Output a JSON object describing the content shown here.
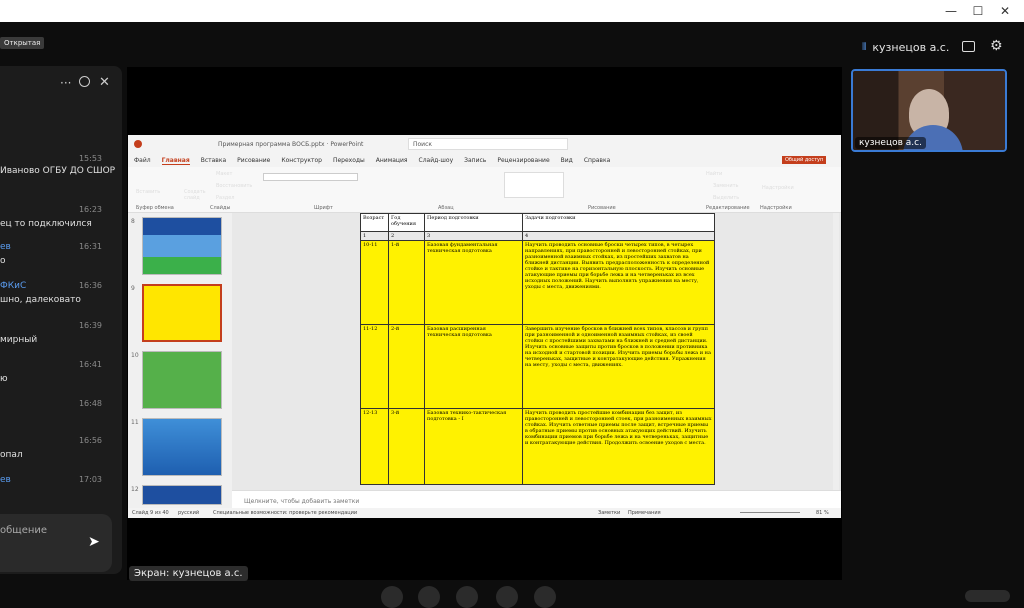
{
  "window": {
    "minimize": "—",
    "maximize": "☐",
    "close": "✕"
  },
  "topbar": {
    "badge": "Открытая",
    "participant_name": "кузнецов а.с.",
    "icons": [
      "microphone-icon",
      "person-card-icon",
      "gear-icon"
    ]
  },
  "chat": {
    "header_icons": [
      "more-icon",
      "search-icon",
      "close-icon"
    ],
    "messages": [
      {
        "time": "15:53",
        "author": "",
        "text": "Иваново ОГБУ ДО СШОР"
      },
      {
        "time": "16:23",
        "author": "",
        "text": "ец то подключился"
      },
      {
        "time": "16:31",
        "author": "ев",
        "text": "о"
      },
      {
        "time": "16:36",
        "author": "ФКиС",
        "text": "шно, далековато"
      },
      {
        "time": "16:39",
        "author": "",
        "text": "мирный"
      },
      {
        "time": "16:41",
        "author": "",
        "text": "ю"
      },
      {
        "time": "16:48",
        "author": "",
        "text": ""
      },
      {
        "time": "16:56",
        "author": "",
        "text": "опал"
      },
      {
        "time": "17:03",
        "author": "ев",
        "text": ""
      }
    ],
    "input_placeholder": "общение",
    "send_icon": "send-icon"
  },
  "ppt": {
    "title": "Примерная программа ВОСБ.pptx · PowerPoint",
    "search": "Поиск",
    "tabs": [
      "Файл",
      "Главная",
      "Вставка",
      "Рисование",
      "Конструктор",
      "Переходы",
      "Анимация",
      "Слайд-шоу",
      "Запись",
      "Рецензирование",
      "Вид",
      "Справка"
    ],
    "share": "Общий доступ",
    "ribbon": {
      "insert": "Вставить",
      "new_slide": "Создать слайд",
      "layout": "Макет",
      "reset": "Восстановить",
      "section": "Раздел",
      "find": "Найти",
      "replace": "Заменить",
      "select": "Выделить",
      "addins": "Надстройки",
      "groups": [
        "Буфер обмена",
        "Слайды",
        "Шрифт",
        "Абзац",
        "Рисование",
        "Редактирование",
        "Надстройки"
      ]
    },
    "thumb_numbers": [
      "8",
      "9",
      "10",
      "11",
      "12"
    ],
    "table": {
      "headers": [
        "Возраст",
        "Год обучения",
        "Период подготовки",
        "Задачи подготовки"
      ],
      "numbers": [
        "1",
        "2",
        "3",
        "4"
      ],
      "rows": [
        {
          "age": "10-11",
          "year": "1-й",
          "period": "Базовая фундаментальная техническая подготовка",
          "tasks": "Научить проводить основные броски четырех типов, в четырех направлениях, при правосторонней и левосторонней стойках, при разноименной взаимных стойках, из простейших захватов на ближней дистанции. Выявить предрасположенность к определенной стойке и тактике на горизонтальную плоскость. Изучить основные атакующие приемы при борьбе лежа и на четвереньках из всех исходных положений. Научить выполнять упражнения на месту, уходы с места, движениями."
        },
        {
          "age": "11-12",
          "year": "2-й",
          "period": "Базовая расширенная техническая подготовка",
          "tasks": "Завершить изучение бросков в ближней всех типов, классов и групп при разноименной и одноименной взаимных стойках, из своей стойки с простейшими захватами на ближней и средней дистанции. Изучить основные защиты против бросков в положении противника на исходной и стартовой позиции. Изучить приемы борьбы лежа и на четвереньках, защитные и контратакующие действия. Упражнения на месту, уходы с места, движениях."
        },
        {
          "age": "12-13",
          "year": "3-й",
          "period": "Базовая технико-тактическая подготовка - I",
          "tasks": "Научить проводить простейшие комбинации без защит, из правосторонней и левосторонней стоек, при разноименных взаимных стойках. Изучить ответные приемы после защит, встречные приемы в обратные приемы против основных атакующих действий. Изучить комбинации приемов при борьбе лежа и на четвереньках, защитные и контратакующие действия. Продолжить освоение уходов с места."
        }
      ]
    },
    "notes_placeholder": "Щелкните, чтобы добавить заметки",
    "status": {
      "slide": "Слайд 9 из 40",
      "lang": "русский",
      "accessibility": "Специальные возможности: проверьте рекомендации",
      "notes": "Заметки",
      "comments": "Примечания",
      "zoom": "81 %"
    }
  },
  "screen_label": "Экран: кузнецов а.с.",
  "video": {
    "name": "кузнецов а.с."
  },
  "colors": {
    "table_fill": "#fff200",
    "accent": "#c43e1c",
    "link": "#5a9cf0",
    "video_border": "#3a7bd5"
  }
}
